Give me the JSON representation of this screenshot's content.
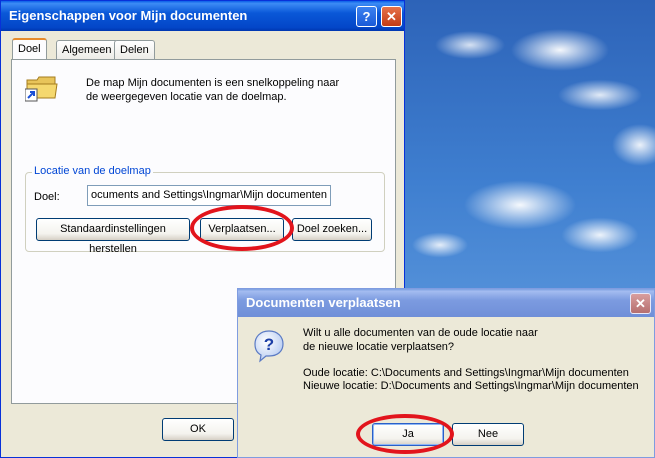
{
  "properties_window": {
    "title": "Eigenschappen voor Mijn documenten",
    "help_glyph": "?",
    "close_glyph": "✕",
    "tabs": [
      {
        "label": "Doel",
        "active": true
      },
      {
        "label": "Algemeen",
        "active": false
      },
      {
        "label": "Delen",
        "active": false
      }
    ],
    "description_line1": "De map Mijn documenten is een snelkoppeling naar",
    "description_line2": "de weergegeven locatie van de doelmap.",
    "group_title": "Locatie van de doelmap",
    "target_label": "Doel:",
    "target_value": "ocuments and Settings\\Ingmar\\Mijn documenten",
    "buttons": {
      "restore": "Standaardinstellingen herstellen",
      "move": "Verplaatsen...",
      "find": "Doel zoeken..."
    },
    "ok_label": "OK",
    "folder_icon": "folder-shortcut-icon"
  },
  "move_dialog": {
    "title": "Documenten verplaatsen",
    "close_glyph": "✕",
    "question_icon": "question-icon",
    "question_line1": "Wilt u alle documenten van de oude locatie naar",
    "question_line2": "de nieuwe locatie verplaatsen?",
    "old_location": "Oude locatie: C:\\Documents and Settings\\Ingmar\\Mijn documenten",
    "new_location": "Nieuwe locatie: D:\\Documents and Settings\\Ingmar\\Mijn documenten",
    "yes_label": "Ja",
    "no_label": "Nee"
  },
  "colors": {
    "highlight_ring": "#e2141c",
    "titlebar_active": "#0a58d8",
    "window_face": "#ece9d8"
  }
}
